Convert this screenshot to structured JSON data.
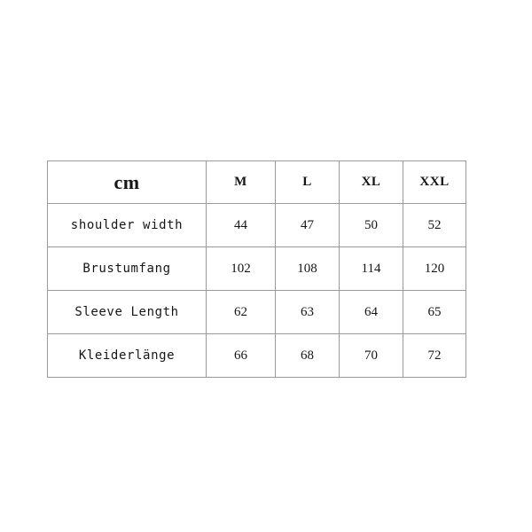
{
  "chart_data": {
    "type": "table",
    "title": "",
    "unit_label": "cm",
    "categories": [
      "M",
      "L",
      "XL",
      "XXL"
    ],
    "measurements": [
      "shoulder width",
      "Brustumfang",
      "Sleeve Length",
      "Kleiderlänge"
    ],
    "series": [
      {
        "name": "shoulder width",
        "values": [
          44,
          47,
          50,
          52
        ]
      },
      {
        "name": "Brustumfang",
        "values": [
          102,
          108,
          114,
          120
        ]
      },
      {
        "name": "Sleeve Length",
        "values": [
          62,
          63,
          64,
          65
        ]
      },
      {
        "name": "Kleiderlänge",
        "values": [
          66,
          68,
          70,
          72
        ]
      }
    ],
    "xlabel": "",
    "ylabel": "",
    "grid": true,
    "legend_position": "none"
  },
  "table": {
    "unit_header": "cm",
    "size_headers": [
      "M",
      "L",
      "XL",
      "XXL"
    ],
    "rows": [
      {
        "label": "shoulder width",
        "values": [
          "44",
          "47",
          "50",
          "52"
        ]
      },
      {
        "label": "Brustumfang",
        "values": [
          "102",
          "108",
          "114",
          "120"
        ]
      },
      {
        "label": "Sleeve Length",
        "values": [
          "62",
          "63",
          "64",
          "65"
        ]
      },
      {
        "label": "Kleiderlänge",
        "values": [
          "66",
          "68",
          "70",
          "72"
        ]
      }
    ]
  },
  "colors": {
    "background": "#ffffff",
    "border": "#9a9a9a",
    "header_text": "#111111",
    "label_text": "#1a1a1a",
    "value_text": "#22242c"
  }
}
